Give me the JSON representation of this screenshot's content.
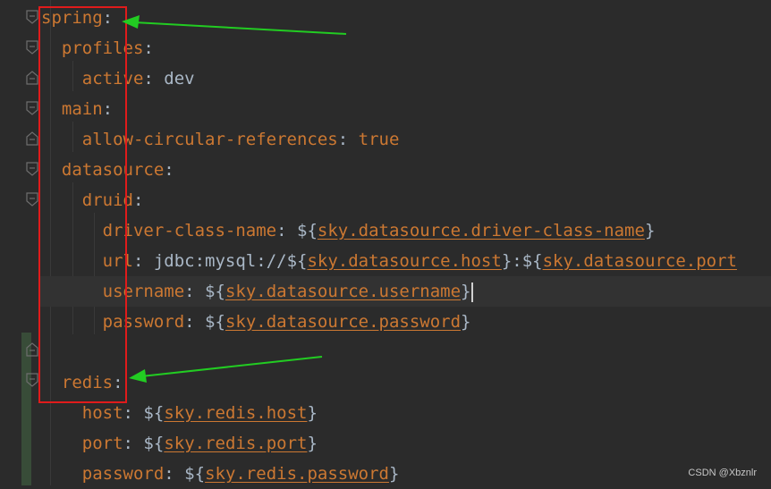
{
  "editor": {
    "lines": [
      {
        "segments": [
          {
            "t": "spring",
            "c": "key"
          },
          {
            "t": ":",
            "c": "punct"
          }
        ]
      },
      {
        "segments": [
          {
            "t": "  "
          },
          {
            "t": "profiles",
            "c": "key"
          },
          {
            "t": ":",
            "c": "punct"
          }
        ]
      },
      {
        "segments": [
          {
            "t": "    "
          },
          {
            "t": "active",
            "c": "key"
          },
          {
            "t": ": ",
            "c": "punct"
          },
          {
            "t": "dev",
            "c": "val"
          }
        ]
      },
      {
        "segments": [
          {
            "t": "  "
          },
          {
            "t": "main",
            "c": "key"
          },
          {
            "t": ":",
            "c": "punct"
          }
        ]
      },
      {
        "segments": [
          {
            "t": "    "
          },
          {
            "t": "allow-circular-references",
            "c": "key"
          },
          {
            "t": ": ",
            "c": "punct"
          },
          {
            "t": "true",
            "c": "bool"
          }
        ]
      },
      {
        "segments": [
          {
            "t": "  "
          },
          {
            "t": "datasource",
            "c": "key"
          },
          {
            "t": ":",
            "c": "punct"
          }
        ]
      },
      {
        "segments": [
          {
            "t": "    "
          },
          {
            "t": "druid",
            "c": "key"
          },
          {
            "t": ":",
            "c": "punct"
          }
        ]
      },
      {
        "segments": [
          {
            "t": "      "
          },
          {
            "t": "driver-class-name",
            "c": "key"
          },
          {
            "t": ": ",
            "c": "punct"
          },
          {
            "t": "${",
            "c": "brace"
          },
          {
            "t": "sky.datasource.driver-class-name",
            "c": "ref"
          },
          {
            "t": "}",
            "c": "brace"
          }
        ]
      },
      {
        "segments": [
          {
            "t": "      "
          },
          {
            "t": "url",
            "c": "key"
          },
          {
            "t": ": ",
            "c": "punct"
          },
          {
            "t": "jdbc:mysql://",
            "c": "val"
          },
          {
            "t": "${",
            "c": "brace"
          },
          {
            "t": "sky.datasource.host",
            "c": "ref"
          },
          {
            "t": "}",
            "c": "brace"
          },
          {
            "t": ":",
            "c": "val"
          },
          {
            "t": "${",
            "c": "brace"
          },
          {
            "t": "sky.datasource.port",
            "c": "ref"
          }
        ]
      },
      {
        "segments": [
          {
            "t": "      "
          },
          {
            "t": "username",
            "c": "key"
          },
          {
            "t": ": ",
            "c": "punct"
          },
          {
            "t": "${",
            "c": "brace"
          },
          {
            "t": "sky.datasource.username",
            "c": "ref"
          },
          {
            "t": "}",
            "c": "brace"
          }
        ],
        "current": true
      },
      {
        "segments": [
          {
            "t": "      "
          },
          {
            "t": "password",
            "c": "key"
          },
          {
            "t": ": ",
            "c": "punct"
          },
          {
            "t": "${",
            "c": "brace"
          },
          {
            "t": "sky.datasource.password",
            "c": "ref"
          },
          {
            "t": "}",
            "c": "brace"
          }
        ]
      },
      {
        "segments": []
      },
      {
        "segments": [
          {
            "t": "  "
          },
          {
            "t": "redis",
            "c": "key"
          },
          {
            "t": ":",
            "c": "punct"
          }
        ]
      },
      {
        "segments": [
          {
            "t": "    "
          },
          {
            "t": "host",
            "c": "key"
          },
          {
            "t": ": ",
            "c": "punct"
          },
          {
            "t": "${",
            "c": "brace"
          },
          {
            "t": "sky.redis.host",
            "c": "ref"
          },
          {
            "t": "}",
            "c": "brace"
          }
        ]
      },
      {
        "segments": [
          {
            "t": "    "
          },
          {
            "t": "port",
            "c": "key"
          },
          {
            "t": ": ",
            "c": "punct"
          },
          {
            "t": "${",
            "c": "brace"
          },
          {
            "t": "sky.redis.port",
            "c": "ref"
          },
          {
            "t": "}",
            "c": "brace"
          }
        ]
      },
      {
        "segments": [
          {
            "t": "    "
          },
          {
            "t": "password",
            "c": "key"
          },
          {
            "t": ": ",
            "c": "punct"
          },
          {
            "t": "${",
            "c": "brace"
          },
          {
            "t": "sky.redis.password",
            "c": "ref"
          },
          {
            "t": "}",
            "c": "brace"
          }
        ]
      }
    ]
  },
  "annotations": {
    "box_color": "#e01b1b",
    "arrow_color": "#22cc22"
  },
  "watermark": {
    "text": "CSDN @Xbznlr"
  },
  "colors": {
    "background": "#2b2b2b",
    "key": "#cc7832",
    "text": "#a9b7c6",
    "current_line": "#323232"
  }
}
